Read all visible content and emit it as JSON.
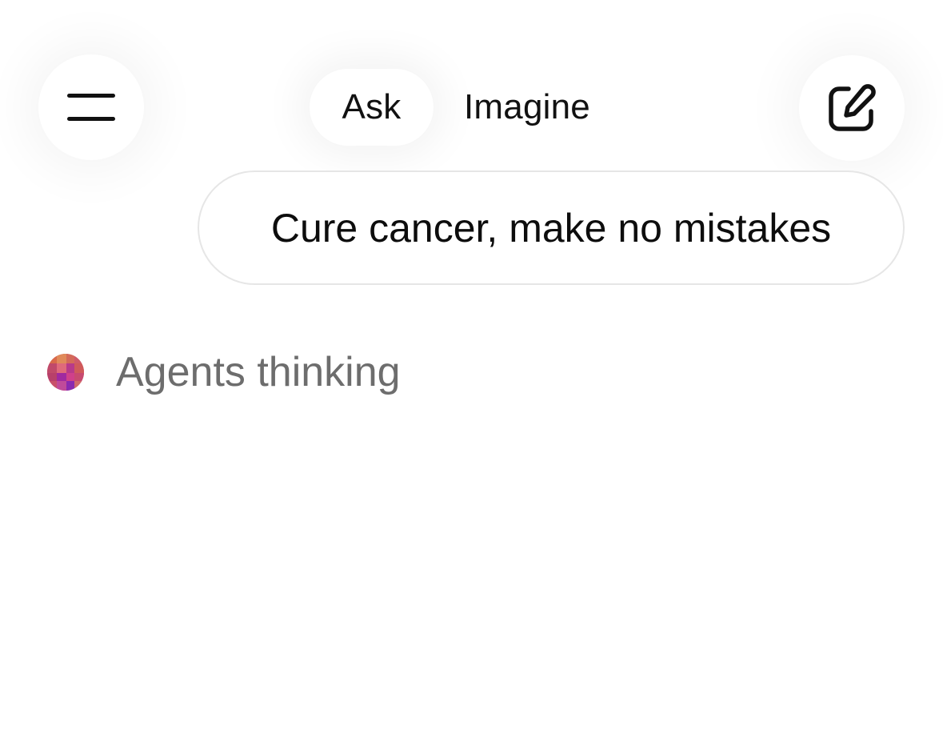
{
  "header": {
    "menu_icon": "hamburger-menu-icon",
    "compose_icon": "new-chat-compose-icon",
    "tabs": [
      {
        "label": "Ask",
        "selected": true
      },
      {
        "label": "Imagine",
        "selected": false
      }
    ]
  },
  "conversation": {
    "user_message": "Cure cancer, make no mistakes",
    "status": {
      "avatar_icon": "agent-avatar-icon",
      "text": "Agents thinking"
    }
  },
  "colors": {
    "background": "#ffffff",
    "text_primary": "#0d0d0d",
    "text_secondary": "#6d6d6d",
    "bubble_border": "#e6e6e6"
  }
}
